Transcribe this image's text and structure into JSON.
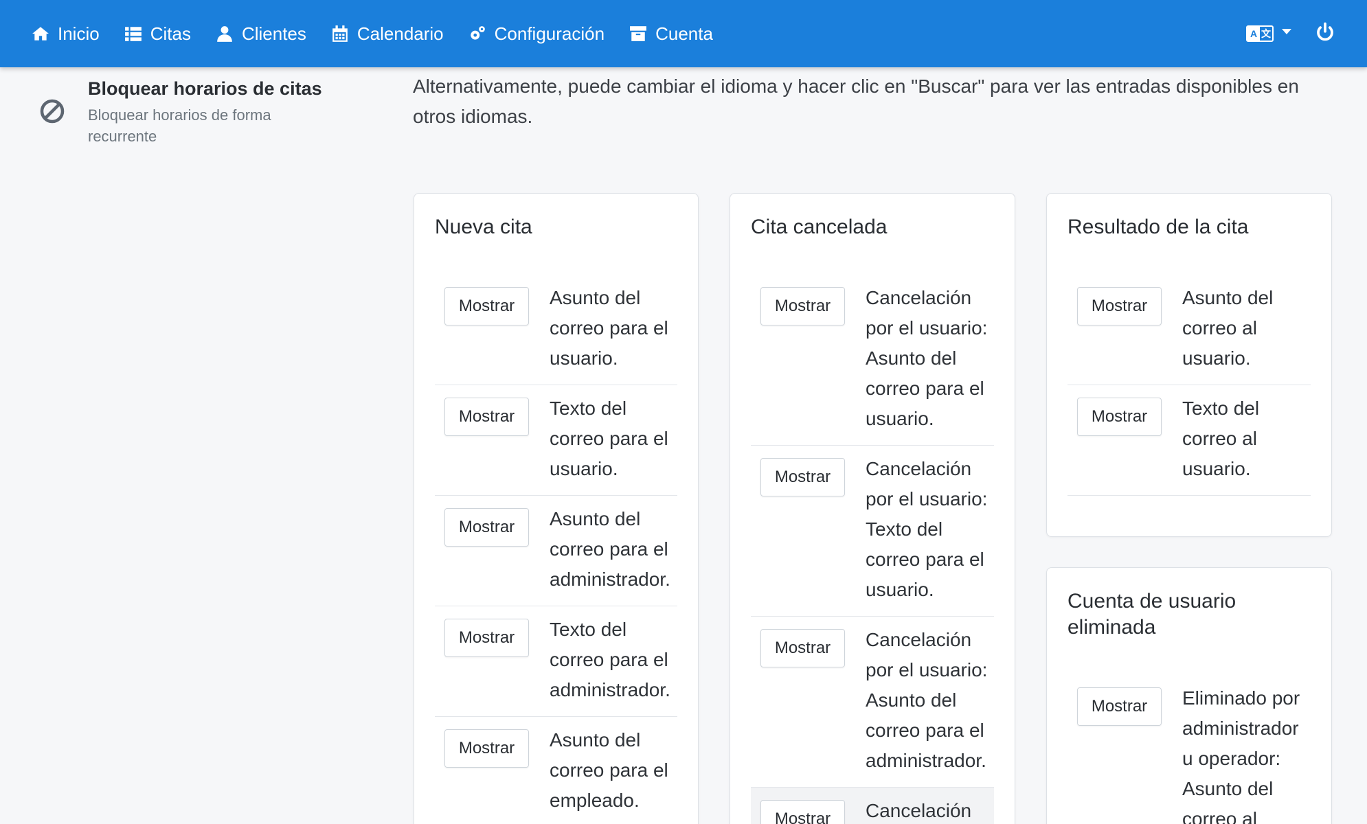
{
  "navbar": {
    "items": [
      {
        "label": "Inicio",
        "icon": "home-icon"
      },
      {
        "label": "Citas",
        "icon": "list-icon"
      },
      {
        "label": "Clientes",
        "icon": "user-icon"
      },
      {
        "label": "Calendario",
        "icon": "calendar-icon"
      },
      {
        "label": "Configuración",
        "icon": "cogs-icon"
      },
      {
        "label": "Cuenta",
        "icon": "archive-icon"
      }
    ],
    "language_icon_letters": [
      "A",
      "文"
    ]
  },
  "sidebar": {
    "item": {
      "title": "Bloquear horarios de citas",
      "subtitle": "Bloquear horarios de forma recurrente",
      "icon": "ban-icon"
    }
  },
  "intro_text": "Alternativamente, puede cambiar el idioma y hacer clic en \"Buscar\" para ver las entradas disponibles en otros idiomas.",
  "button_label": "Mostrar",
  "cards": {
    "nueva_cita": {
      "title": "Nueva cita",
      "rows": [
        "Asunto del correo para el usuario.",
        "Texto del correo para el usuario.",
        "Asunto del correo para el administrador.",
        "Texto del correo para el administrador.",
        "Asunto del correo para el empleado."
      ]
    },
    "cita_cancelada": {
      "title": "Cita cancelada",
      "rows": [
        "Cancelación por el usuario: Asunto del correo para el usuario.",
        "Cancelación por el usuario: Texto del correo para el usuario.",
        "Cancelación por el usuario: Asunto del correo para el administrador.",
        "Cancelación"
      ]
    },
    "resultado_cita": {
      "title": "Resultado de la cita",
      "rows": [
        "Asunto del correo al usuario.",
        "Texto del correo al usuario."
      ]
    },
    "cuenta_eliminada": {
      "title": "Cuenta de usuario eliminada",
      "rows": [
        "Eliminado por administrador u operador: Asunto del correo al"
      ]
    }
  },
  "colors": {
    "navbar": "#1b7fdb",
    "background": "#f6f7f9"
  }
}
